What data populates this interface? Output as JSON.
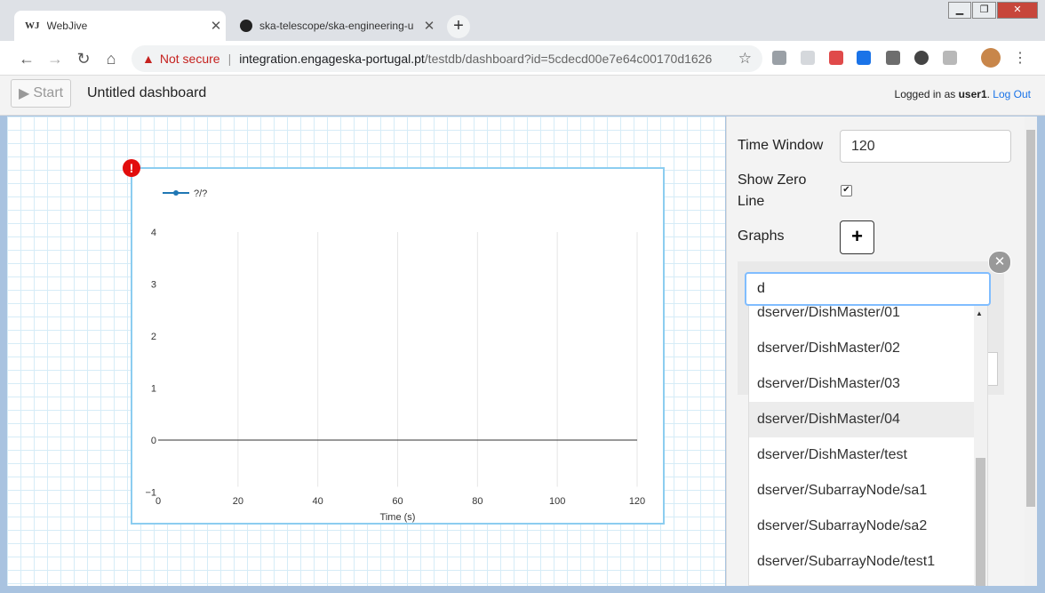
{
  "browser": {
    "tabs": [
      {
        "icon": "WJ",
        "title": "WebJive"
      },
      {
        "title": "ska-telescope/ska-engineering-u"
      }
    ],
    "security_label": "Not secure",
    "url_host": "integration.engageska-portugal.pt",
    "url_path": "/testdb/dashboard?id=5cdecd00e7e64c00170d1626"
  },
  "app": {
    "start_label": "Start",
    "dashboard_title": "Untitled dashboard",
    "logged_in_prefix": "Logged in as",
    "username": "user1",
    "logout_label": "Log Out"
  },
  "panel": {
    "time_window_label": "Time Window",
    "time_window_value": "120",
    "show_zero_line_label_1": "Show Zero",
    "show_zero_line_label_2": "Line",
    "show_zero_line_checked": true,
    "graphs_label": "Graphs",
    "search_value": "d",
    "options": [
      "dserver/DishMaster/01",
      "dserver/DishMaster/02",
      "dserver/DishMaster/03",
      "dserver/DishMaster/04",
      "dserver/DishMaster/test",
      "dserver/SubarrayNode/sa1",
      "dserver/SubarrayNode/sa2",
      "dserver/SubarrayNode/test1"
    ],
    "highlighted_option": "dserver/DishMaster/04"
  },
  "chart_data": {
    "type": "line",
    "legend": [
      "?/?"
    ],
    "series": [
      {
        "name": "?/?",
        "values": []
      }
    ],
    "zero_line": true,
    "xlabel": "Time (s)",
    "x_ticks": [
      0,
      20,
      40,
      60,
      80,
      100,
      120
    ],
    "y_ticks": [
      -1,
      0,
      1,
      2,
      3,
      4
    ],
    "xlim": [
      0,
      120
    ],
    "ylim": [
      -1,
      4
    ],
    "legend_position": "top-left",
    "colors": {
      "series": "#1f77b4",
      "grid": "#e6e6e6",
      "zero_line": "#333333"
    }
  }
}
